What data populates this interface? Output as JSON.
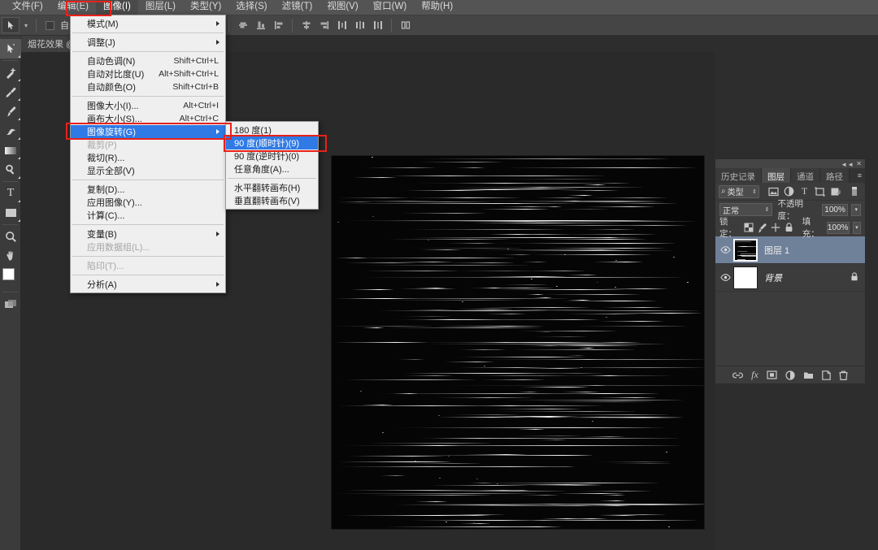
{
  "app": {
    "title": "Adobe Photoshop"
  },
  "menubar": {
    "items": [
      {
        "label": "文件(F)",
        "active": false
      },
      {
        "label": "编辑(E)",
        "active": false
      },
      {
        "label": "图像(I)",
        "active": true
      },
      {
        "label": "图层(L)",
        "active": false
      },
      {
        "label": "类型(Y)",
        "active": false
      },
      {
        "label": "选择(S)",
        "active": false
      },
      {
        "label": "滤镜(T)",
        "active": false
      },
      {
        "label": "视图(V)",
        "active": false
      },
      {
        "label": "窗口(W)",
        "active": false
      },
      {
        "label": "帮助(H)",
        "active": false
      }
    ]
  },
  "options_bar": {
    "auto_select_label": "自动选择：",
    "auto_select_checked": false
  },
  "document": {
    "tab_label": "烟花效果 @",
    "close_glyph": "✕"
  },
  "image_menu": {
    "items": [
      {
        "label": "模式(M)",
        "shortcut": "",
        "submenu": true,
        "disabled": false,
        "highlight": false
      },
      {
        "sep": true
      },
      {
        "label": "调整(J)",
        "shortcut": "",
        "submenu": true,
        "disabled": false,
        "highlight": false
      },
      {
        "sep": true
      },
      {
        "label": "自动色调(N)",
        "shortcut": "Shift+Ctrl+L",
        "submenu": false,
        "disabled": false,
        "highlight": false
      },
      {
        "label": "自动对比度(U)",
        "shortcut": "Alt+Shift+Ctrl+L",
        "submenu": false,
        "disabled": false,
        "highlight": false
      },
      {
        "label": "自动颜色(O)",
        "shortcut": "Shift+Ctrl+B",
        "submenu": false,
        "disabled": false,
        "highlight": false
      },
      {
        "sep": true
      },
      {
        "label": "图像大小(I)...",
        "shortcut": "Alt+Ctrl+I",
        "submenu": false,
        "disabled": false,
        "highlight": false
      },
      {
        "label": "画布大小(S)...",
        "shortcut": "Alt+Ctrl+C",
        "submenu": false,
        "disabled": false,
        "highlight": false
      },
      {
        "label": "图像旋转(G)",
        "shortcut": "",
        "submenu": true,
        "disabled": false,
        "highlight": true
      },
      {
        "label": "裁剪(P)",
        "shortcut": "",
        "submenu": false,
        "disabled": true,
        "highlight": false
      },
      {
        "label": "裁切(R)...",
        "shortcut": "",
        "submenu": false,
        "disabled": false,
        "highlight": false
      },
      {
        "label": "显示全部(V)",
        "shortcut": "",
        "submenu": false,
        "disabled": false,
        "highlight": false
      },
      {
        "sep": true
      },
      {
        "label": "复制(D)...",
        "shortcut": "",
        "submenu": false,
        "disabled": false,
        "highlight": false
      },
      {
        "label": "应用图像(Y)...",
        "shortcut": "",
        "submenu": false,
        "disabled": false,
        "highlight": false
      },
      {
        "label": "计算(C)...",
        "shortcut": "",
        "submenu": false,
        "disabled": false,
        "highlight": false
      },
      {
        "sep": true
      },
      {
        "label": "变量(B)",
        "shortcut": "",
        "submenu": true,
        "disabled": false,
        "highlight": false
      },
      {
        "label": "应用数据组(L)...",
        "shortcut": "",
        "submenu": false,
        "disabled": true,
        "highlight": false
      },
      {
        "sep": true
      },
      {
        "label": "陷印(T)...",
        "shortcut": "",
        "submenu": false,
        "disabled": true,
        "highlight": false
      },
      {
        "sep": true
      },
      {
        "label": "分析(A)",
        "shortcut": "",
        "submenu": true,
        "disabled": false,
        "highlight": false
      }
    ]
  },
  "rotate_submenu": {
    "items": [
      {
        "label": "180 度(1)",
        "highlight": false
      },
      {
        "label": "90 度(顺时针)(9)",
        "highlight": true
      },
      {
        "label": "90 度(逆时针)(0)",
        "highlight": false
      },
      {
        "label": "任意角度(A)...",
        "highlight": false
      },
      {
        "sep": true
      },
      {
        "label": "水平翻转画布(H)",
        "highlight": false
      },
      {
        "label": "垂直翻转画布(V)",
        "highlight": false
      }
    ]
  },
  "toolbar": {
    "tools": [
      {
        "name": "move-tool",
        "glyph": "move",
        "selected": true
      },
      {
        "sep": false
      },
      {
        "name": "magic-wand-tool",
        "glyph": "wand",
        "selected": false
      },
      {
        "name": "eyedropper-tool",
        "glyph": "dropper",
        "selected": false
      },
      {
        "name": "brush-tool",
        "glyph": "brush",
        "selected": false
      },
      {
        "name": "history-brush-tool",
        "glyph": "historybrush",
        "selected": false
      },
      {
        "name": "gradient-tool",
        "glyph": "gradient",
        "selected": false
      },
      {
        "name": "dodge-tool",
        "glyph": "dodge",
        "selected": false
      },
      {
        "name": "type-tool",
        "glyph": "type",
        "selected": false
      },
      {
        "name": "rectangle-tool",
        "glyph": "rect",
        "selected": false
      },
      {
        "name": "zoom-tool",
        "glyph": "zoom",
        "selected": false
      },
      {
        "name": "hand-tool",
        "glyph": "hand",
        "selected": false
      }
    ]
  },
  "layers_panel": {
    "tabs": [
      {
        "label": "历史记录",
        "active": false
      },
      {
        "label": "图层",
        "active": true
      },
      {
        "label": "通道",
        "active": false
      },
      {
        "label": "路径",
        "active": false
      }
    ],
    "filter": {
      "kind_label": "类型",
      "search_glyph": "⌕",
      "icons": [
        "pixel-filter-icon",
        "adjustment-filter-icon",
        "type-filter-icon",
        "shape-filter-icon",
        "smart-object-filter-icon",
        "filter-toggle-icon"
      ]
    },
    "blend_mode": "正常",
    "opacity_label": "不透明度：",
    "opacity_value": "100%",
    "lock_label": "锁定：",
    "fill_label": "填充：",
    "fill_value": "100%",
    "lock_icons": [
      "lock-transparent-icon",
      "lock-image-icon",
      "lock-position-icon",
      "lock-all-icon"
    ],
    "layers": [
      {
        "name": "图层 1",
        "selected": true,
        "visible": true,
        "locked": false,
        "thumb": "dark",
        "italic": false
      },
      {
        "name": "背景",
        "selected": false,
        "visible": true,
        "locked": true,
        "thumb": "white",
        "italic": true
      }
    ],
    "bottom_icons": [
      "link-layers-icon",
      "layer-style-fx-icon",
      "layer-mask-icon",
      "adjustment-layer-icon",
      "new-group-icon",
      "new-layer-icon",
      "delete-layer-icon"
    ]
  },
  "colors": {
    "menu_highlight": "#2f7ae5",
    "red_annotation": "#e8211a",
    "layer_selected": "#6f8099",
    "panel_bg": "#3c3c3c",
    "canvas_bg": "#050505"
  },
  "annotations": [
    {
      "name": "image-menu-title-highlight"
    },
    {
      "name": "image-rotation-item-highlight"
    },
    {
      "name": "rotate-90-cw-highlight"
    }
  ]
}
